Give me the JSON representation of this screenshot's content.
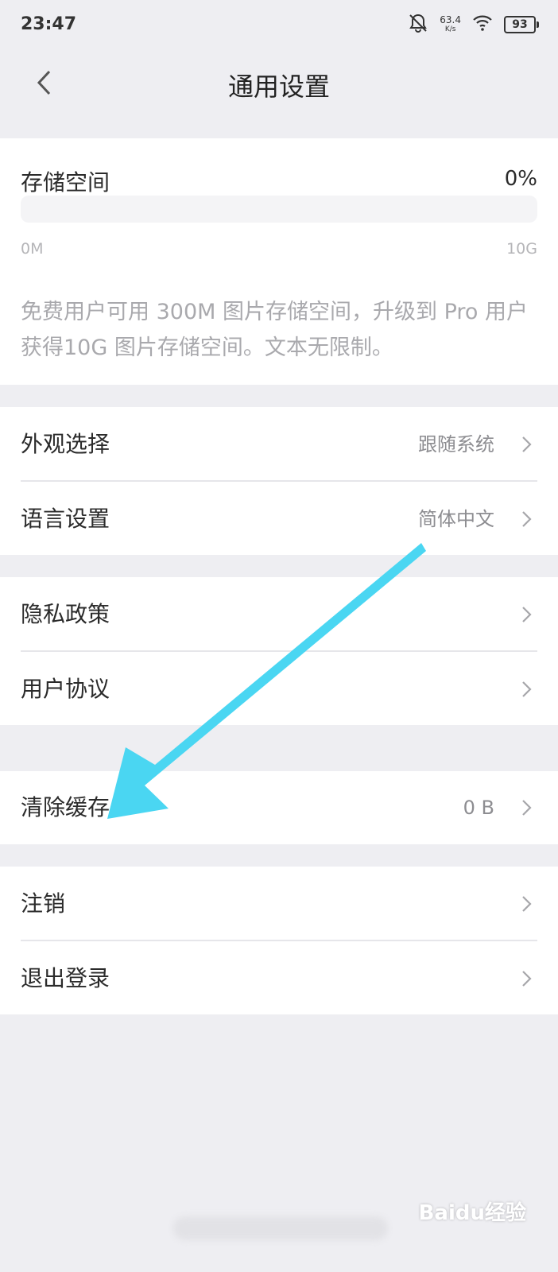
{
  "status": {
    "time": "23:47",
    "speed_value": "63.4",
    "speed_unit": "K/s",
    "battery": "93"
  },
  "header": {
    "title": "通用设置"
  },
  "storage": {
    "title": "存储空间",
    "percent_label": "0%",
    "used_fraction": 0,
    "min_label": "0M",
    "max_label": "10G",
    "description": "免费用户可用 300M 图片存储空间，升级到 Pro 用户获得10G 图片存储空间。文本无限制。"
  },
  "groups": {
    "display": {
      "appearance": {
        "label": "外观选择",
        "value": "跟随系统"
      },
      "language": {
        "label": "语言设置",
        "value": "简体中文"
      }
    },
    "legal": {
      "privacy": {
        "label": "隐私政策"
      },
      "agreement": {
        "label": "用户协议"
      }
    },
    "cache": {
      "clear": {
        "label": "清除缓存",
        "value": "0 B"
      }
    },
    "account": {
      "cancel": {
        "label": "注销"
      },
      "logout": {
        "label": "退出登录"
      }
    }
  },
  "annotation": {
    "arrow_color": "#4ad6f2"
  },
  "watermark": {
    "text": "Baidu经验"
  }
}
